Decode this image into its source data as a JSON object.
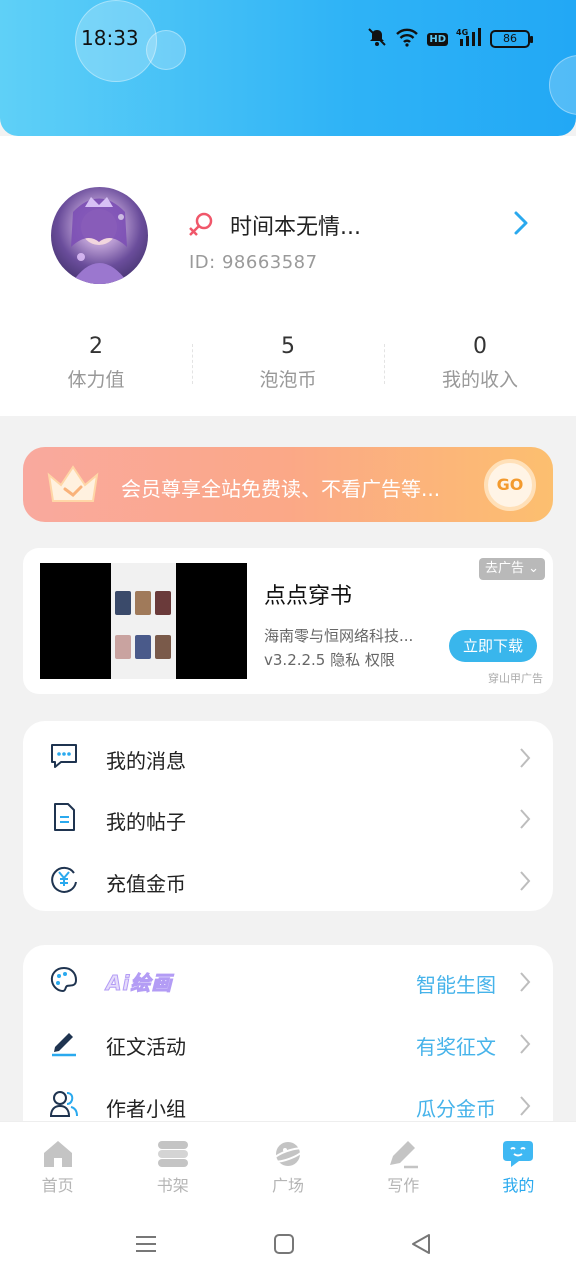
{
  "status_bar": {
    "time": "18:33",
    "battery": "86",
    "network": "4G",
    "hd": "HD"
  },
  "profile": {
    "nickname": "时间本无情...",
    "id_label": "ID:",
    "id_value": "98663587",
    "stats": [
      {
        "value": "2",
        "label": "体力值"
      },
      {
        "value": "5",
        "label": "泡泡币"
      },
      {
        "value": "0",
        "label": "我的收入"
      }
    ]
  },
  "vip": {
    "text": "会员尊享全站免费读、不看广告等...",
    "go_label": "GO"
  },
  "ad": {
    "title": "点点穿书",
    "company": "海南零与恒网络科技...",
    "version_line": "v3.2.2.5  隐私  权限",
    "close_label": "去广告 ⌄",
    "download_label": "立即下载",
    "source": "穿山甲广告"
  },
  "menu1": [
    {
      "icon": "message-icon",
      "label": "我的消息"
    },
    {
      "icon": "document-icon",
      "label": "我的帖子"
    },
    {
      "icon": "yen-coin-icon",
      "label": "充值金币"
    }
  ],
  "menu2": [
    {
      "icon": "palette-icon",
      "label": "Ai绘画",
      "aside": "智能生图"
    },
    {
      "icon": "pen-icon",
      "label": "征文活动",
      "aside": "有奖征文"
    },
    {
      "icon": "group-icon",
      "label": "作者小组",
      "aside": "瓜分金币"
    }
  ],
  "tabs": [
    {
      "label": "首页",
      "icon": "home-icon"
    },
    {
      "label": "书架",
      "icon": "bookshelf-icon"
    },
    {
      "label": "广场",
      "icon": "planet-icon"
    },
    {
      "label": "写作",
      "icon": "write-icon"
    },
    {
      "label": "我的",
      "icon": "chat-bubble-icon",
      "active": true
    }
  ],
  "colors": {
    "accent": "#2aa9ee",
    "header_start": "#5fd0f7",
    "header_end": "#22a8f5",
    "vip_start": "#f9a99e",
    "vip_end": "#fcbf6f"
  }
}
